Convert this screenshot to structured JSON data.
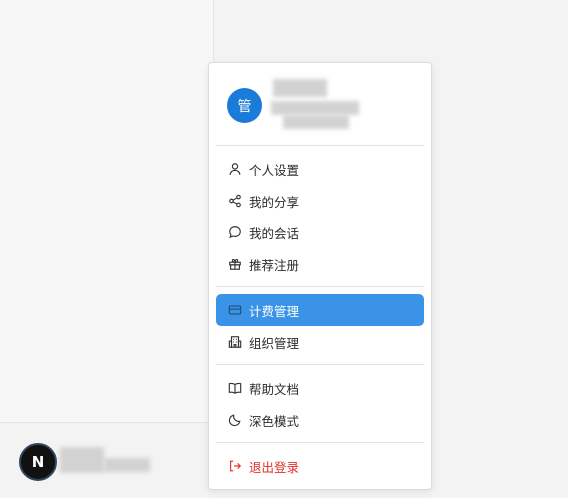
{
  "sidebar": {
    "user_avatar_letter": "N"
  },
  "menu": {
    "avatar_char": "管",
    "items": [
      {
        "label": "个人设置",
        "icon": "user-icon"
      },
      {
        "label": "我的分享",
        "icon": "share-icon"
      },
      {
        "label": "我的会话",
        "icon": "chat-icon"
      },
      {
        "label": "推荐注册",
        "icon": "gift-icon"
      },
      {
        "label": "计费管理",
        "icon": "credit-card-icon",
        "active": true
      },
      {
        "label": "组织管理",
        "icon": "building-icon"
      },
      {
        "label": "帮助文档",
        "icon": "book-icon"
      },
      {
        "label": "深色模式",
        "icon": "moon-icon"
      },
      {
        "label": "退出登录",
        "icon": "logout-icon"
      }
    ]
  },
  "colors": {
    "accent": "#3a93e6",
    "avatar_blue": "#1a7bd9",
    "danger": "#e0312c"
  }
}
